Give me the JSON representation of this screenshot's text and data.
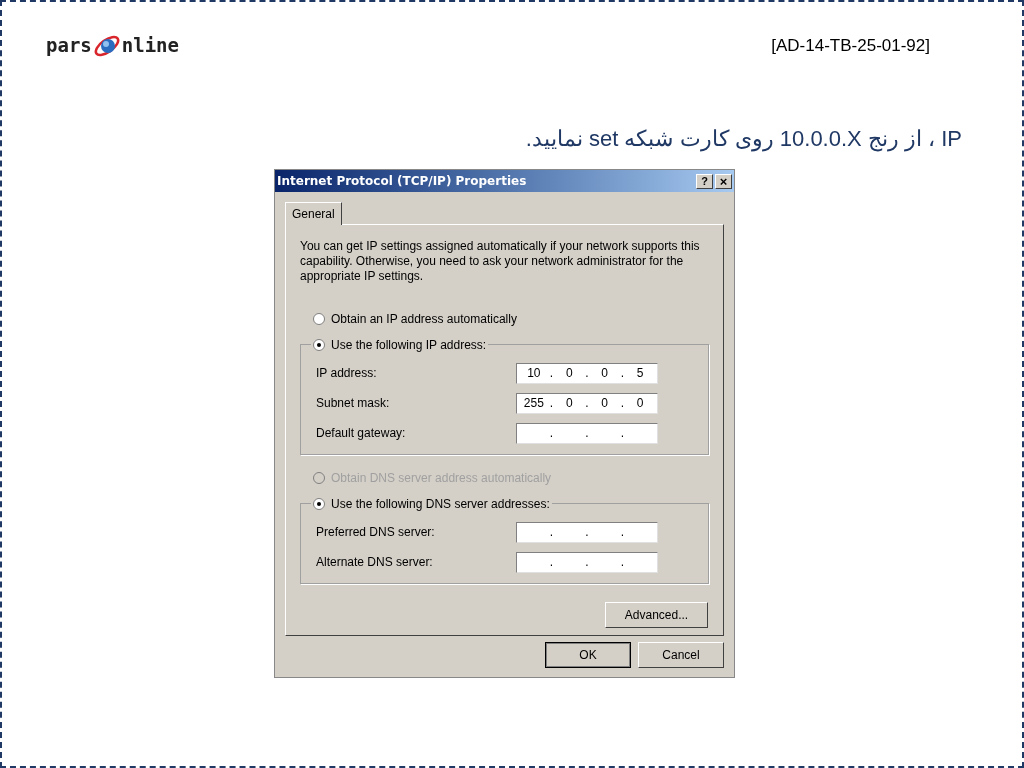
{
  "slide": {
    "logo": {
      "left": "pars",
      "right": "nline"
    },
    "code": "[AD-14-TB-25-01-92]",
    "heading": "IP ، از رنج ⁦10.0.0.X⁩ روی کارت شبکه set نمایید."
  },
  "dialog": {
    "title": "Internet Protocol (TCP/IP) Properties",
    "help": "?",
    "close": "×",
    "tabs": [
      {
        "label": "General",
        "selected": true
      }
    ],
    "intro": "You can get IP settings assigned automatically if your network supports this capability. Otherwise, you need to ask your network administrator for the appropriate IP settings.",
    "sections": [
      {
        "auto": {
          "label": "Obtain an IP address automatically",
          "selected": false,
          "disabled": false
        },
        "manual": {
          "label": "Use the following IP address:",
          "selected": true,
          "disabled": false
        },
        "fields": [
          {
            "label": "IP address:",
            "octets": [
              "10",
              "0",
              "0",
              "5"
            ],
            "separators": [
              ".",
              ".",
              "."
            ]
          },
          {
            "label": "Subnet mask:",
            "octets": [
              "255",
              "0",
              "0",
              "0"
            ],
            "separators": [
              ".",
              ".",
              "."
            ]
          },
          {
            "label": "Default gateway:",
            "separators": [
              ".",
              ".",
              "."
            ]
          }
        ]
      },
      {
        "auto": {
          "label": "Obtain DNS server address automatically",
          "selected": false,
          "disabled": true
        },
        "manual": {
          "label": "Use the following DNS server addresses:",
          "selected": true,
          "disabled": false
        },
        "fields": [
          {
            "label": "Preferred DNS server:",
            "separators": [
              ".",
              ".",
              "."
            ]
          },
          {
            "label": "Alternate DNS server:",
            "separators": [
              ".",
              ".",
              "."
            ]
          }
        ]
      }
    ],
    "advanced": "Advanced...",
    "buttons": [
      "OK",
      "Cancel"
    ]
  }
}
